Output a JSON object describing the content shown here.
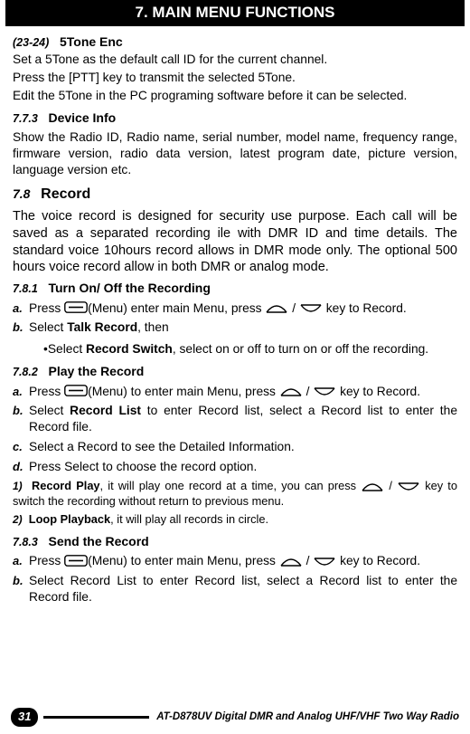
{
  "header": {
    "title": "7. MAIN MENU FUNCTIONS"
  },
  "s23_24": {
    "num": "(23-24)",
    "title": "5Tone Enc",
    "l1": "Set a 5Tone as the default call ID for the current channel.",
    "l2": "Press the [PTT] key to transmit the selected 5Tone.",
    "l3": "Edit the 5Tone in the PC programing software before it can be selected."
  },
  "s773": {
    "num": "7.7.3",
    "title": "Device Info",
    "body": "Show the Radio ID, Radio name, serial number, model name, frequency range, firmware version, radio data version, latest program date, picture version, language version etc."
  },
  "s78": {
    "num": "7.8",
    "title": "Record",
    "body": "The voice record is designed for security use purpose. Each call will be saved as a separated recording ile with  DMR ID and time details. The standard voice 10hours record allows in DMR mode only. The optional 500 hours voice record allow in both DMR or analog mode."
  },
  "s781": {
    "num": "7.8.1",
    "title": "Turn On/ Off the Recording",
    "a": {
      "label": "a.",
      "pre": "Press ",
      "mid": "(Menu) enter main Menu, press ",
      "sep": " / ",
      "post": " key to Record."
    },
    "b": {
      "label": "b.",
      "pre": "Select ",
      "bold": "Talk Record",
      "post": ", then"
    },
    "bullet": {
      "pre": "•Select ",
      "bold": "Record Switch",
      "post": ", select on or off to turn on or off the recording."
    }
  },
  "s782": {
    "num": "7.8.2",
    "title": "Play the Record",
    "a": {
      "label": "a.",
      "pre": "Press ",
      "mid": "(Menu) to enter main Menu, press ",
      "sep": " / ",
      "post": " key to Record."
    },
    "b": {
      "label": "b.",
      "pre": "Select ",
      "bold": "Record List",
      "post": " to enter Record list, select a Record list to enter the Record file."
    },
    "c": {
      "label": "c.",
      "text": "Select a Record to see the Detailed Information."
    },
    "d": {
      "label": "d.",
      "text": "Press Select to choose the record option."
    },
    "n1": {
      "label": "1)",
      "bold": "Record Play",
      "pre": ", it will play one record at a time, you can press ",
      "sep": " / ",
      "post": " key to switch the recording without return to previous menu."
    },
    "n2": {
      "label": "2)",
      "bold": "Loop Playback",
      "post": ", it will play all records in circle."
    }
  },
  "s783": {
    "num": "7.8.3",
    "title": "Send the Record",
    "a": {
      "label": "a.",
      "pre": "Press ",
      "mid": "(Menu) to enter main Menu, press ",
      "sep": " / ",
      "post": " key to Record."
    },
    "b": {
      "label": "b.",
      "text": "Select Record List to enter Record list, select a Record list to enter the Record file."
    }
  },
  "footer": {
    "page": "31",
    "text": "AT-D878UV Digital DMR and Analog UHF/VHF Two Way Radio"
  }
}
